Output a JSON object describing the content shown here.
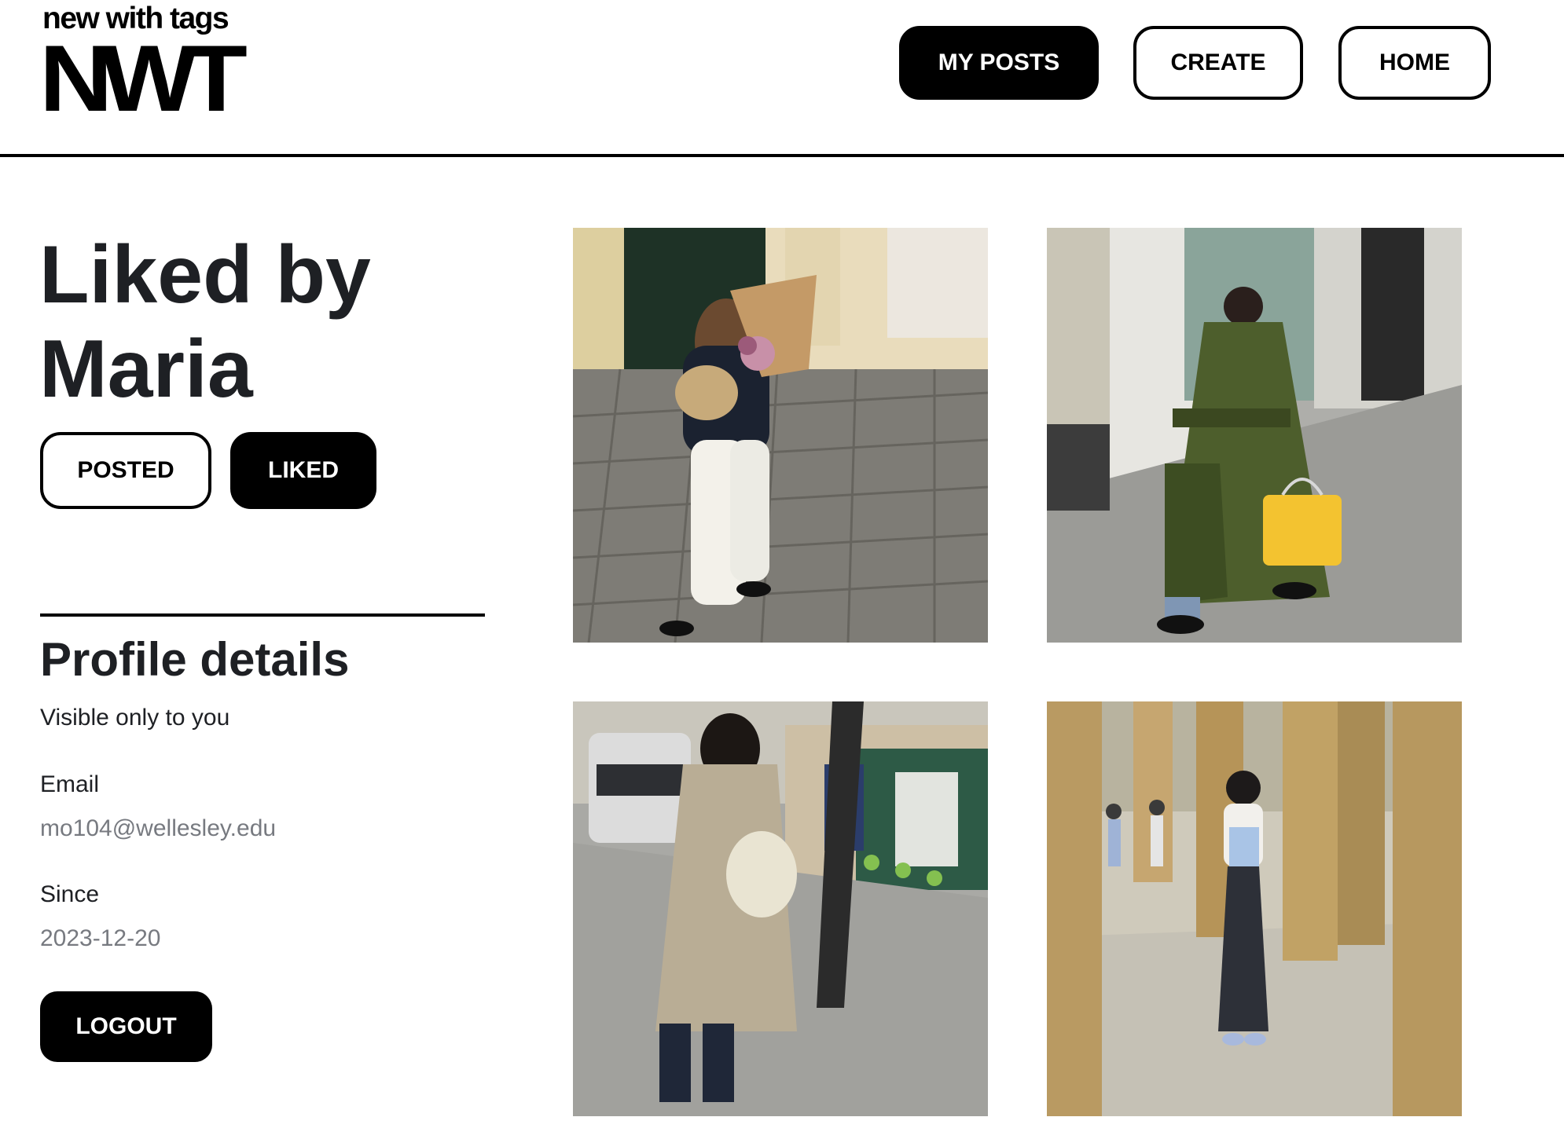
{
  "brand": {
    "tagline": "new with tags",
    "mark": "NWT"
  },
  "nav": {
    "my_posts": "MY POSTS",
    "create": "CREATE",
    "home": "HOME"
  },
  "profile": {
    "title": "Liked by Maria",
    "tabs": {
      "posted": "POSTED",
      "liked": "LIKED",
      "active": "liked"
    },
    "details_heading": "Profile details",
    "details_sub": "Visible only to you",
    "email_label": "Email",
    "email_value": "mo104@wellesley.edu",
    "since_label": "Since",
    "since_value": "2023-12-20",
    "logout": "LOGOUT"
  },
  "posts": [
    {
      "icon": "photo-woman-flowers-cobblestone"
    },
    {
      "icon": "photo-green-leather-coat-yellow-bag"
    },
    {
      "icon": "photo-trench-coat-street"
    },
    {
      "icon": "photo-stone-columns-park"
    }
  ],
  "colors": {
    "accent": "#000000",
    "text": "#1e2024",
    "muted": "#777a80"
  }
}
